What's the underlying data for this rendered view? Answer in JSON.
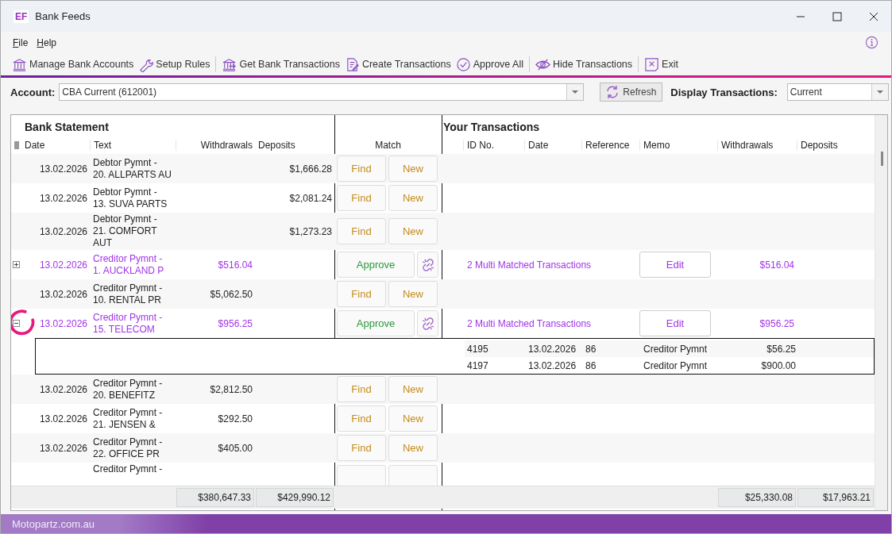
{
  "window": {
    "title": "Bank Feeds",
    "logo": "EF"
  },
  "menu": [
    {
      "label": "File"
    },
    {
      "label": "Help"
    }
  ],
  "toolbar": [
    {
      "label": "Manage Bank Accounts",
      "kind": "bank",
      "separator_after": false
    },
    {
      "label": "Setup Rules",
      "kind": "wrench",
      "separator_after": true
    },
    {
      "label": "Get Bank Transactions",
      "kind": "import",
      "separator_after": false
    },
    {
      "label": "Create Transactions",
      "kind": "document",
      "separator_after": false
    },
    {
      "label": "Approve All",
      "kind": "check",
      "separator_after": true
    },
    {
      "label": "Hide Transactions",
      "kind": "hide",
      "separator_after": true
    },
    {
      "label": "Exit",
      "kind": "exit",
      "separator_after": false
    }
  ],
  "account": {
    "label": "Account:",
    "value": "CBA Current (612001)"
  },
  "refresh_button": "Refresh",
  "display": {
    "label": "Display Transactions:",
    "value": "Current"
  },
  "bank_statement": {
    "title": "Bank Statement",
    "columns": [
      "Date",
      "Text",
      "Withdrawals",
      "Deposits"
    ]
  },
  "match_column": "Match",
  "your_transactions": {
    "title": "Your Transactions",
    "columns": [
      "ID No.",
      "Date",
      "Reference",
      "Memo",
      "Withdrawals",
      "Deposits"
    ]
  },
  "rows": [
    {
      "kind": "plain",
      "date": "13.02.2026",
      "text": "Debtor Pymnt - 20. ALLPARTS AU",
      "deposit": "$1,666.28",
      "find": "Find",
      "new": "New"
    },
    {
      "kind": "plain",
      "date": "13.02.2026",
      "text": "Debtor Pymnt - 13. SUVA PARTS",
      "deposit": "$2,081.24",
      "find": "Find",
      "new": "New"
    },
    {
      "kind": "plain",
      "date": "13.02.2026",
      "text": "Debtor Pymnt - 21. COMFORT AUT",
      "deposit": "$1,273.23",
      "find": "Find",
      "new": "New"
    },
    {
      "kind": "matched",
      "expanded": false,
      "date": "13.02.2026",
      "text": "Creditor Pymnt - 1. AUCKLAND P",
      "withdrawal": "$516.04",
      "approve": "Approve",
      "match": "2 Multi Matched Transactions",
      "edit": "Edit",
      "matched_withdrawal": "$516.04"
    },
    {
      "kind": "plain",
      "date": "13.02.2026",
      "text": "Creditor Pymnt - 10. RENTAL PR",
      "withdrawal": "$5,062.50",
      "find": "Find",
      "new": "New"
    },
    {
      "kind": "matched",
      "expanded": true,
      "highlighted": true,
      "date": "13.02.2026",
      "text": "Creditor Pymnt - 15. TELECOM",
      "withdrawal": "$956.25",
      "approve": "Approve",
      "match": "2 Multi Matched Transactions",
      "edit": "Edit",
      "matched_withdrawal": "$956.25",
      "details": [
        {
          "id": "4195",
          "date": "13.02.2026",
          "reference": "86",
          "memo": "Creditor Pymnt",
          "withdrawal": "$56.25"
        },
        {
          "id": "4197",
          "date": "13.02.2026",
          "reference": "86",
          "memo": "Creditor Pymnt",
          "withdrawal": "$900.00"
        }
      ]
    },
    {
      "kind": "plain",
      "date": "13.02.2026",
      "text": "Creditor Pymnt - 20. BENEFITZ",
      "withdrawal": "$2,812.50",
      "find": "Find",
      "new": "New"
    },
    {
      "kind": "plain",
      "date": "13.02.2026",
      "text": "Creditor Pymnt - 21. JENSEN &",
      "withdrawal": "$292.50",
      "find": "Find",
      "new": "New"
    },
    {
      "kind": "plain",
      "date": "13.02.2026",
      "text": "Creditor Pymnt - 22. OFFICE PR",
      "withdrawal": "$405.00",
      "find": "Find",
      "new": "New"
    },
    {
      "kind": "partial",
      "text": "Creditor Pymnt -"
    }
  ],
  "totals": {
    "bank_withdrawals": "$380,647.33",
    "bank_deposits": "$429,990.12",
    "your_withdrawals": "$25,330.08",
    "your_deposits": "$17,963.21"
  },
  "status_bar": {
    "site": "Motopartz.com.au"
  }
}
